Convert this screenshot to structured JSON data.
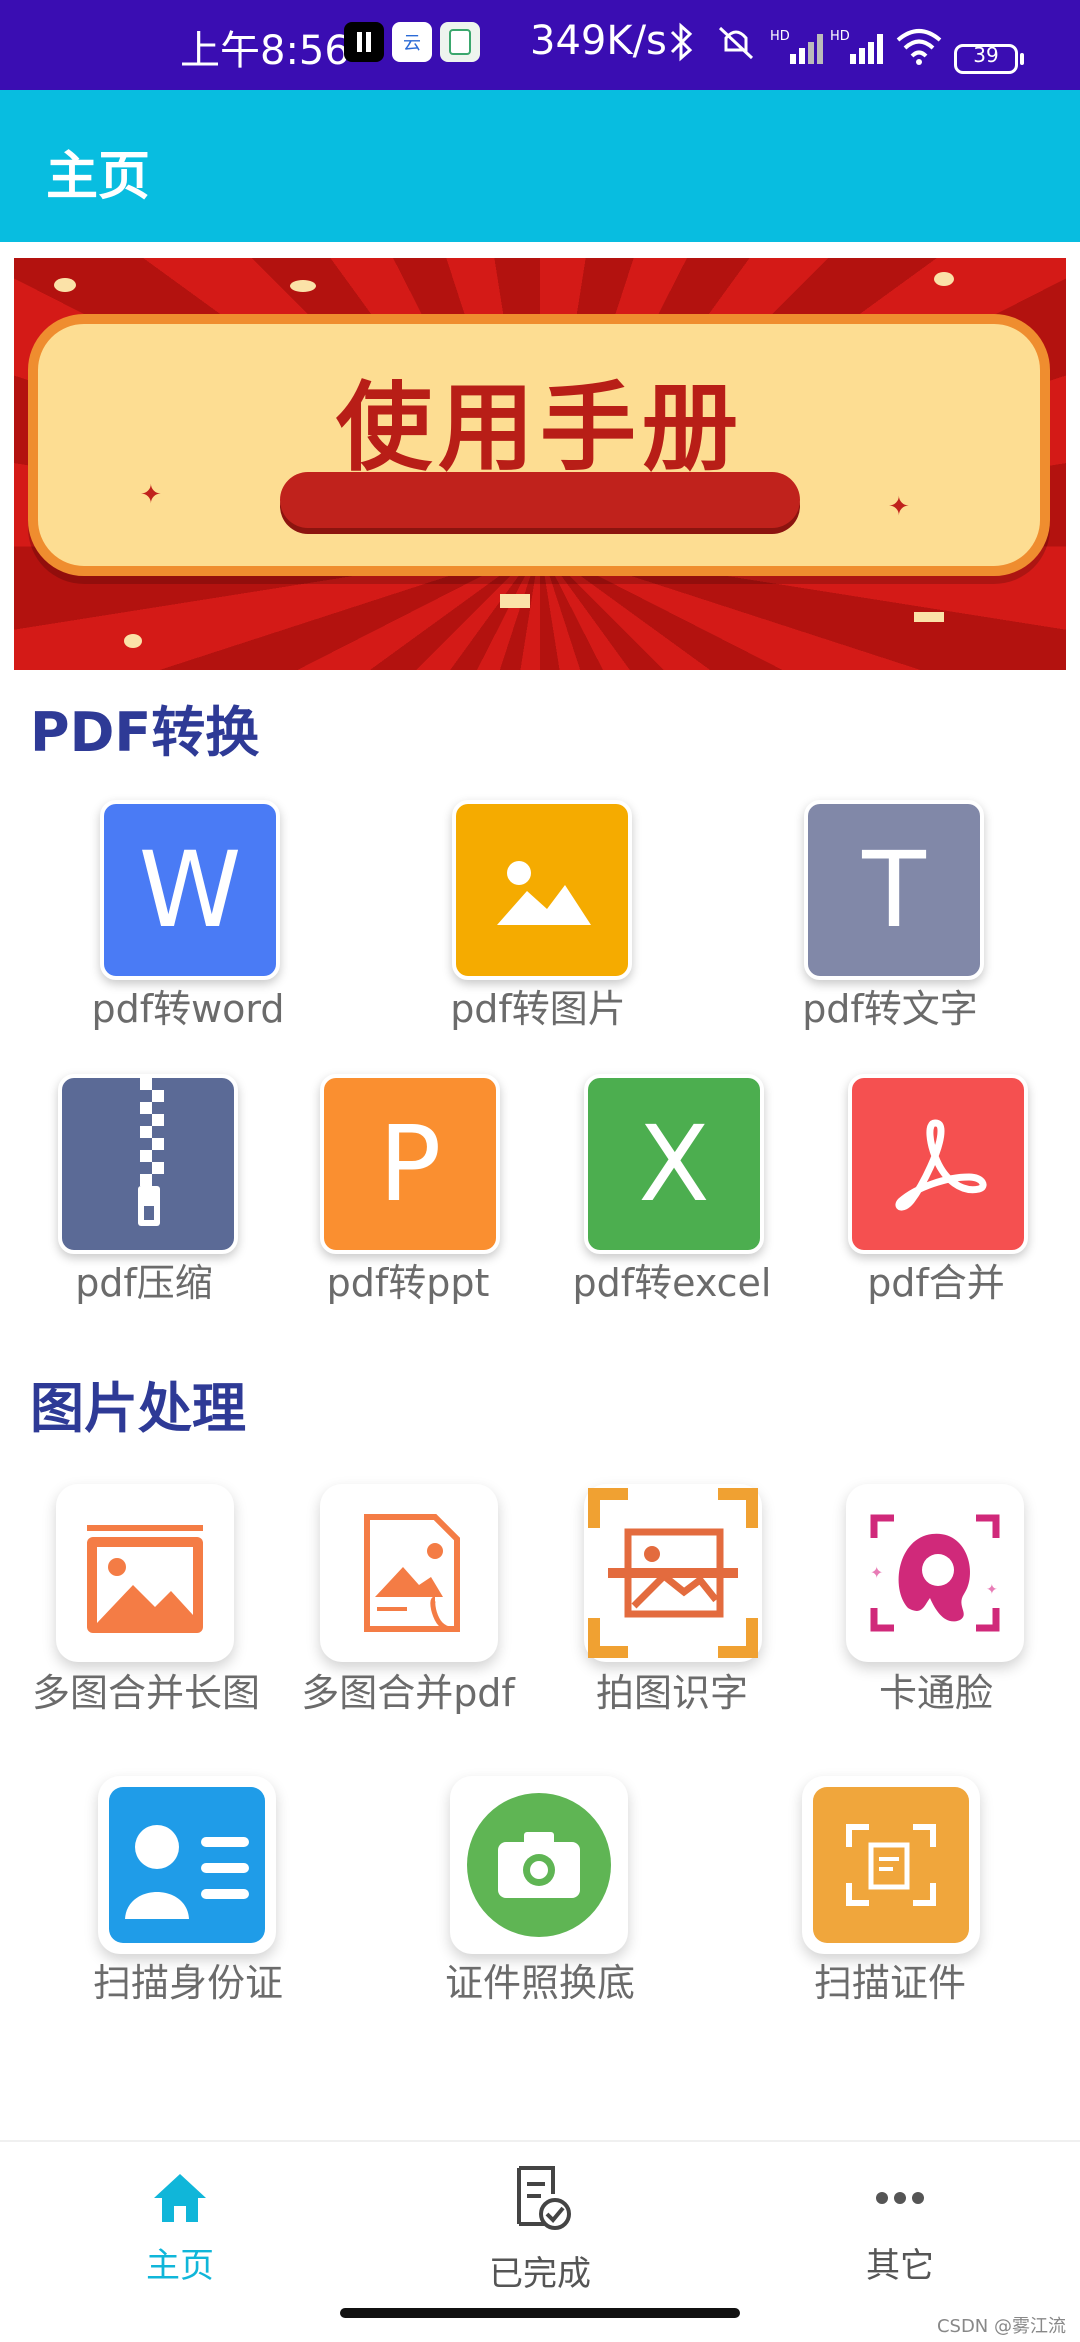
{
  "status_bar": {
    "time": "上午8:56",
    "net_speed": "349K/s",
    "battery": "39",
    "sig1": "HD",
    "sig2": "HD"
  },
  "app_bar": {
    "title": "主页"
  },
  "banner": {
    "title": "使用手册"
  },
  "sections": {
    "pdf": "PDF转换",
    "image": "图片处理"
  },
  "pdf_tools": [
    {
      "label": "pdf转word",
      "letter": "W",
      "color": "#4a7bf5"
    },
    {
      "label": "pdf转图片",
      "color": "#f5ab00"
    },
    {
      "label": "pdf转文字",
      "letter": "T",
      "color": "#8188a8"
    },
    {
      "label": "pdf压缩",
      "color": "#5b6a96"
    },
    {
      "label": "pdf转ppt",
      "letter": "P",
      "color": "#fa8f30"
    },
    {
      "label": "pdf转excel",
      "letter": "X",
      "color": "#4cae4f"
    },
    {
      "label": "pdf合并",
      "color": "#f55050"
    }
  ],
  "image_tools": [
    {
      "label": "多图合并长图"
    },
    {
      "label": "多图合并pdf"
    },
    {
      "label": "拍图识字"
    },
    {
      "label": "卡通脸"
    },
    {
      "label": "扫描身份证"
    },
    {
      "label": "证件照换底"
    },
    {
      "label": "扫描证件"
    }
  ],
  "bottom_nav": [
    {
      "label": "主页",
      "icon": "home-icon",
      "active": true
    },
    {
      "label": "已完成",
      "icon": "document-check-icon",
      "active": false
    },
    {
      "label": "其它",
      "icon": "more-dots-icon",
      "active": false
    }
  ],
  "watermark": "CSDN @雾江流",
  "colors": {
    "accent": "#08bde0",
    "status_bar": "#3a0db2",
    "section_heading": "#2e3a96"
  }
}
